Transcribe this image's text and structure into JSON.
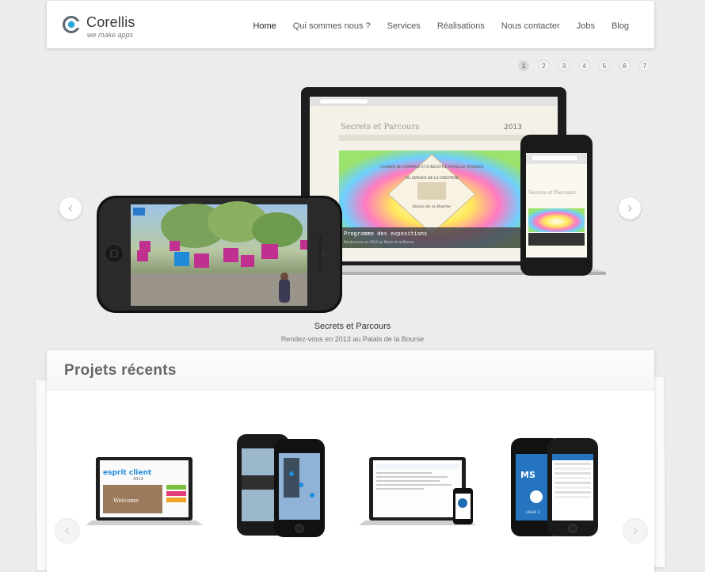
{
  "header": {
    "logo_name": "Corellis",
    "logo_tagline": "we make apps",
    "nav": [
      "Home",
      "Qui sommes nous ?",
      "Services",
      "Réalisations",
      "Nous contacter",
      "Jobs",
      "Blog"
    ]
  },
  "slider": {
    "pages": [
      "1",
      "2",
      "3",
      "4",
      "5",
      "6",
      "7"
    ],
    "active_page": "1",
    "prev_icon": "chevron-left-icon",
    "next_icon": "chevron-right-icon",
    "arrow_prev": "‹",
    "arrow_next": "›"
  },
  "hero": {
    "title": "Secrets et Parcours",
    "subtitle": "Rendez-vous en 2013 au Palais de la Bourse",
    "site_brand": "Secrets et Parcours",
    "site_year": "2013",
    "banner_text": "Programme des expositions",
    "banner_sub": "Rendez-vous en 2013 au Palais de la Bourse",
    "chamber_text": "CHAMBRE DE COMMERCE ET D'INDUSTRIE MARSEILLE PROVENCE",
    "service_text": "AU SERVICE DE LA CRÉATION",
    "palais_text": "Palais de la Bourse"
  },
  "projects": {
    "title": "Projets récents",
    "item1_brand": "esprit client",
    "item1_year": "2013",
    "item1_welcome": "Welcome",
    "item4_brand": "MS",
    "item4_sub": "LIGUE 2"
  },
  "colors": {
    "accent": "#27a7d8",
    "background": "#ececec",
    "magenta": "#c0308f"
  }
}
